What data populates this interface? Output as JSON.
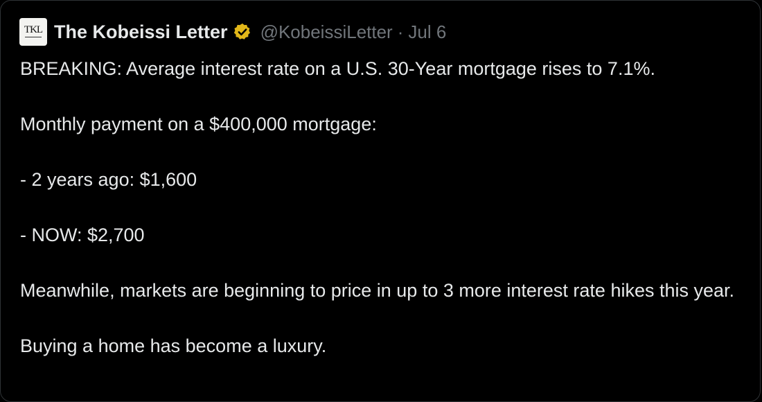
{
  "tweet": {
    "author": {
      "avatar_text": "TKL",
      "display_name": "The Kobeissi Letter",
      "verified_icon": "gold-verified-badge-icon",
      "handle": "@KobeissiLetter",
      "separator": "·",
      "date": "Jul 6"
    },
    "lines": [
      "BREAKING: Average interest rate on a U.S. 30-Year mortgage rises to 7.1%.",
      "Monthly payment on a $400,000 mortgage:",
      "- 2 years ago: $1,600",
      "- NOW: $2,700",
      "Meanwhile, markets are beginning to price in up to 3 more interest rate hikes this year.",
      "Buying a home has become a luxury."
    ]
  },
  "colors": {
    "background": "#000000",
    "primary_text": "#e7e9ea",
    "secondary_text": "#71767b",
    "badge": "#e2b719",
    "border": "#2f3336"
  }
}
